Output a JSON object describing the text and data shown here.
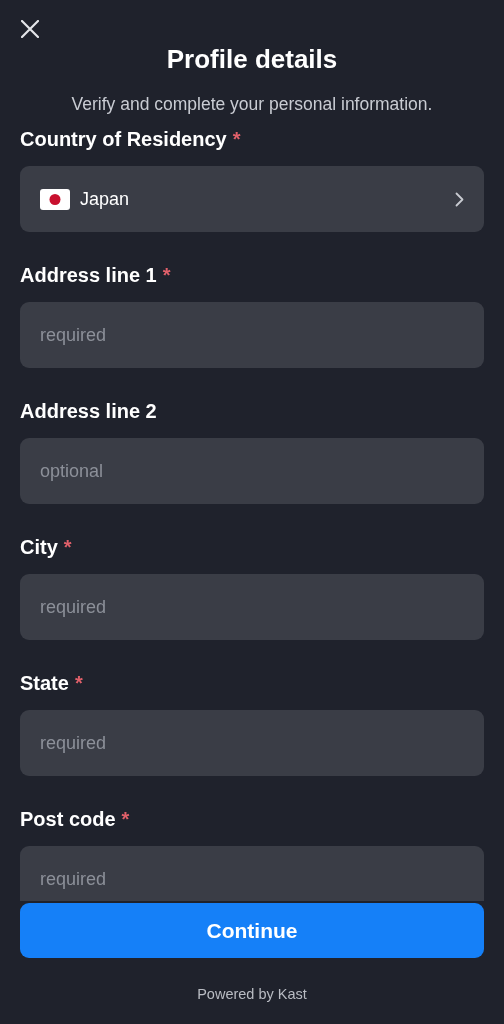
{
  "title": "Profile details",
  "subtitle": "Verify and complete your personal information.",
  "fields": [
    {
      "kind": "select",
      "label": "Country of Residency",
      "required_mark": "*",
      "value": "Japan"
    },
    {
      "kind": "text",
      "label": "Address line 1",
      "required_mark": "*",
      "placeholder": "required"
    },
    {
      "kind": "text",
      "label": "Address line 2",
      "placeholder": "optional"
    },
    {
      "kind": "text",
      "label": "City",
      "required_mark": "*",
      "placeholder": "required"
    },
    {
      "kind": "text",
      "label": "State",
      "required_mark": "*",
      "placeholder": "required"
    },
    {
      "kind": "text",
      "label": "Post code",
      "required_mark": "*",
      "placeholder": "required"
    }
  ],
  "button": "Continue",
  "footer": "Powered by Kast"
}
